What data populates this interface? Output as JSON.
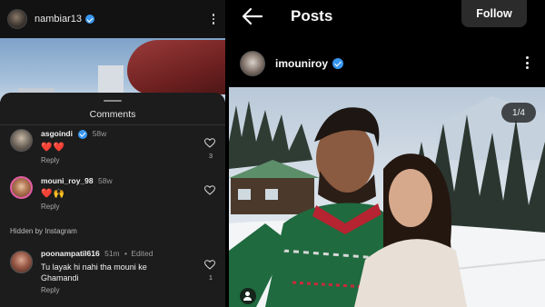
{
  "left_panel": {
    "header": {
      "username": "nambiar13",
      "verified_icon": "verified-badge-icon",
      "menu_icon": "more-options-icon"
    },
    "comments_sheet": {
      "title": "Comments",
      "comments": [
        {
          "username": "asgoindi",
          "verified": true,
          "time": "58w",
          "text": "❤️❤️",
          "reply_label": "Reply",
          "likes": "3"
        },
        {
          "username": "mouni_roy_98",
          "verified": false,
          "time": "58w",
          "text": "❤️🙌",
          "reply_label": "Reply",
          "likes": ""
        }
      ],
      "hidden_label": "Hidden by Instagram",
      "hidden_comment": {
        "username": "poonampatil616",
        "time": "51m",
        "edited": "Edited",
        "text": "Tu layak hi nahi tha mouni ke Ghamandi",
        "reply_label": "Reply",
        "likes": "1"
      }
    }
  },
  "right_panel": {
    "header": {
      "title": "Posts",
      "follow_label": "Follow",
      "back_icon": "back-arrow-icon"
    },
    "post": {
      "username": "imouniroy",
      "verified": true,
      "image_counter": "1/4",
      "tag_icon": "user-tag-icon"
    }
  },
  "colors": {
    "accent_verified": "#3897f0",
    "heart_red": "#ff4d6d",
    "sheet_bg": "#1c1c1c",
    "page_bg": "#000000"
  }
}
